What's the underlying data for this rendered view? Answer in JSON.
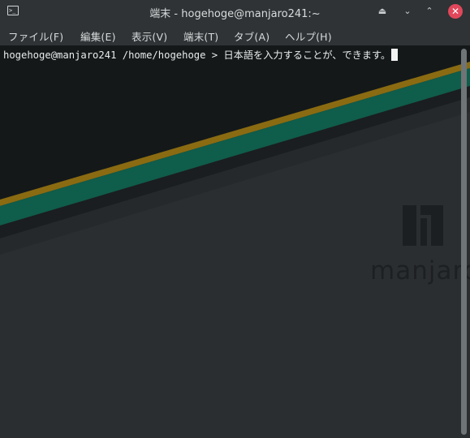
{
  "window": {
    "title": "端末 - hogehoge@manjaro241:~",
    "app_icon_glyph": ">_",
    "buttons": {
      "eject": "⏏",
      "minimize": "⌄",
      "maximize": "⌃",
      "close": "✕"
    }
  },
  "menu": {
    "items": [
      "ファイル(F)",
      "編集(E)",
      "表示(V)",
      "端末(T)",
      "タブ(A)",
      "ヘルプ(H)"
    ]
  },
  "terminal": {
    "prompt_line": "hogehoge@manjaro241 /home/hogehoge > 日本語を入力することが、できます。"
  },
  "wallpaper": {
    "brand_text": "manjaro",
    "colors": {
      "green": "#16a085",
      "yellow": "#b8860b",
      "dark": "#15191a",
      "gray": "#2b2e30"
    }
  }
}
